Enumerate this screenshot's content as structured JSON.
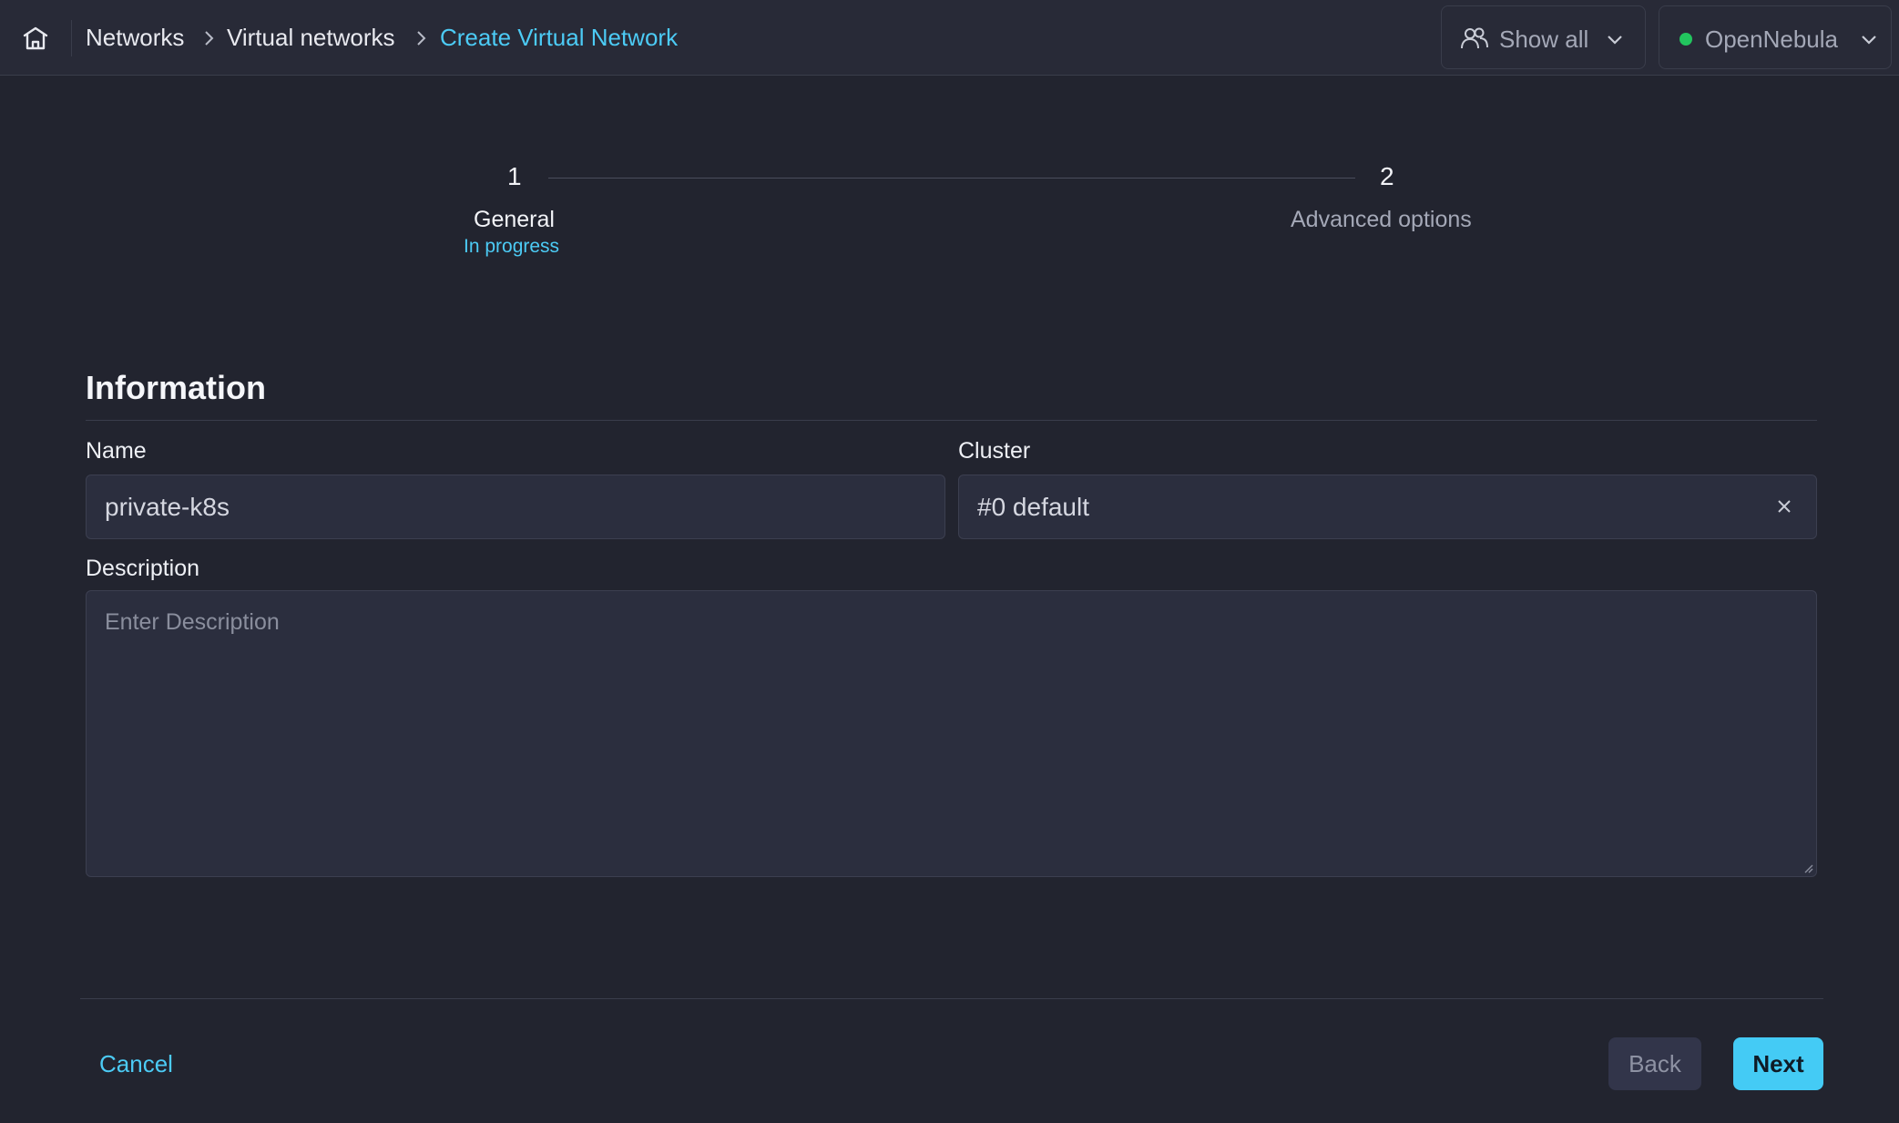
{
  "header": {
    "breadcrumb": [
      "Networks",
      "Virtual networks",
      "Create Virtual Network"
    ],
    "group_filter": "Show all",
    "zone": "OpenNebula",
    "zone_status_color": "#22c55e"
  },
  "stepper": {
    "steps": [
      {
        "number": "1",
        "title": "General",
        "status": "In progress"
      },
      {
        "number": "2",
        "title": "Advanced options"
      }
    ]
  },
  "form": {
    "section_title": "Information",
    "name_label": "Name",
    "name_value": "private-k8s",
    "cluster_label": "Cluster",
    "cluster_value": "#0 default",
    "description_label": "Description",
    "description_placeholder": "Enter Description"
  },
  "footer": {
    "cancel_label": "Cancel",
    "back_label": "Back",
    "next_label": "Next"
  },
  "colors": {
    "accent": "#4ccbf5",
    "background": "#22242f",
    "header_background": "#282a37"
  }
}
